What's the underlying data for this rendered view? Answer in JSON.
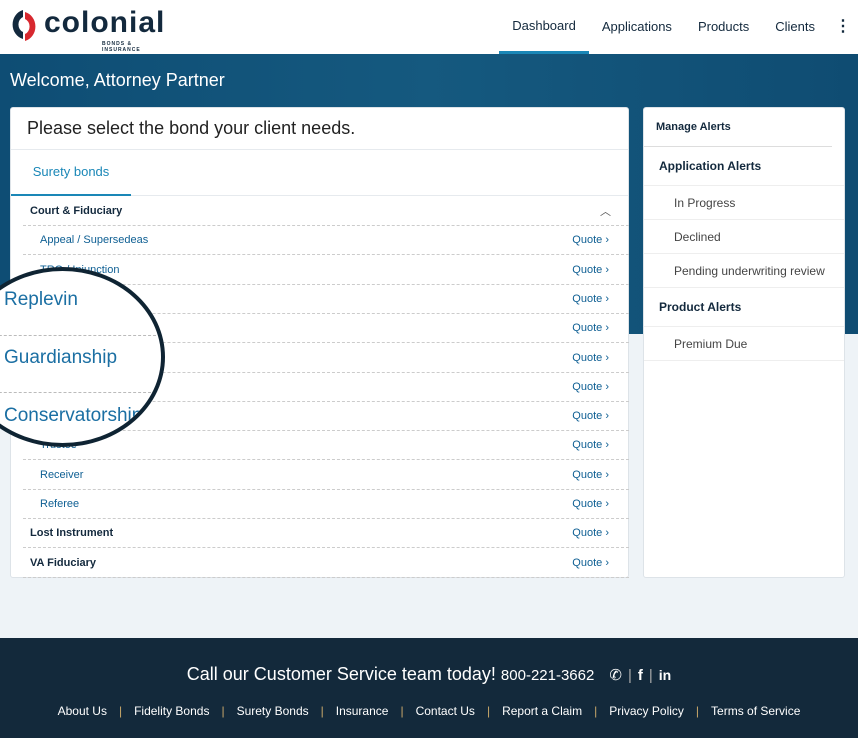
{
  "brand": {
    "name": "colonial",
    "tagline": "BONDS & INSURANCE",
    "colors": {
      "navy": "#13293d",
      "red": "#d7282f",
      "accent": "#1a87b7"
    }
  },
  "nav": {
    "items": [
      "Dashboard",
      "Applications",
      "Products",
      "Clients"
    ],
    "active": "Dashboard",
    "more_icon": "kebab-icon"
  },
  "welcome": "Welcome, Attorney Partner",
  "bonds": {
    "title": "Please select the bond your client needs.",
    "tab": "Surety bonds",
    "quote_label": "Quote",
    "rows": [
      {
        "label": "Court & Fiduciary",
        "category": true,
        "expanded": true
      },
      {
        "label": "Appeal / Supersedeas",
        "quote": true
      },
      {
        "label": "TRO / Injunction",
        "quote": true
      },
      {
        "label": "",
        "quote": true
      },
      {
        "label": "",
        "quote": true
      },
      {
        "label": "",
        "quote": true
      },
      {
        "label": "",
        "quote": true
      },
      {
        "label": "",
        "quote": true
      },
      {
        "label": "Trustee",
        "quote": true
      },
      {
        "label": "Receiver",
        "quote": true
      },
      {
        "label": "Referee",
        "quote": true
      },
      {
        "label": "Lost Instrument",
        "category": true,
        "quote": true
      },
      {
        "label": "VA Fiduciary",
        "category": true,
        "quote": true
      }
    ]
  },
  "magnifier": [
    "Replevin",
    "Guardianship",
    "Conservatorship"
  ],
  "alerts": {
    "title": "Manage Alerts",
    "sections": [
      {
        "title": "Application Alerts",
        "items": [
          "In Progress",
          "Declined",
          "Pending underwriting review"
        ]
      },
      {
        "title": "Product Alerts",
        "items": [
          "Premium Due"
        ]
      }
    ]
  },
  "footer": {
    "call_text": "Call our Customer Service team today!",
    "phone": "800-221-3662",
    "links": [
      "About Us",
      "Fidelity Bonds",
      "Surety Bonds",
      "Insurance",
      "Contact Us",
      "Report a Claim",
      "Privacy Policy",
      "Terms of Service"
    ]
  }
}
